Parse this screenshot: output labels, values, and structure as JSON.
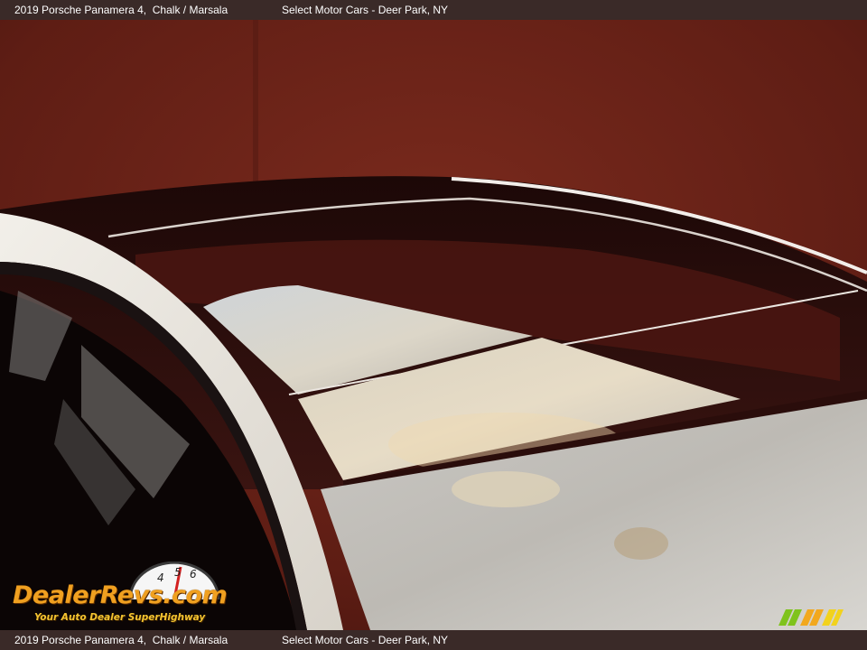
{
  "caption": {
    "vehicle": "2019 Porsche Panamera 4,  Chalk / Marsala",
    "dealer": "Select Motor Cars - Deer Park, NY"
  },
  "watermark": {
    "brand": "DealerRevs.com",
    "tagline": "Your Auto Dealer SuperHighway",
    "gauge_digits": [
      "4",
      "5",
      "6"
    ]
  },
  "photo": {
    "subject": "panoramic-sunroof",
    "wall_color": "#6e2419",
    "roof_color": "#e6e2da",
    "glass_color": "#2a0c0a"
  }
}
